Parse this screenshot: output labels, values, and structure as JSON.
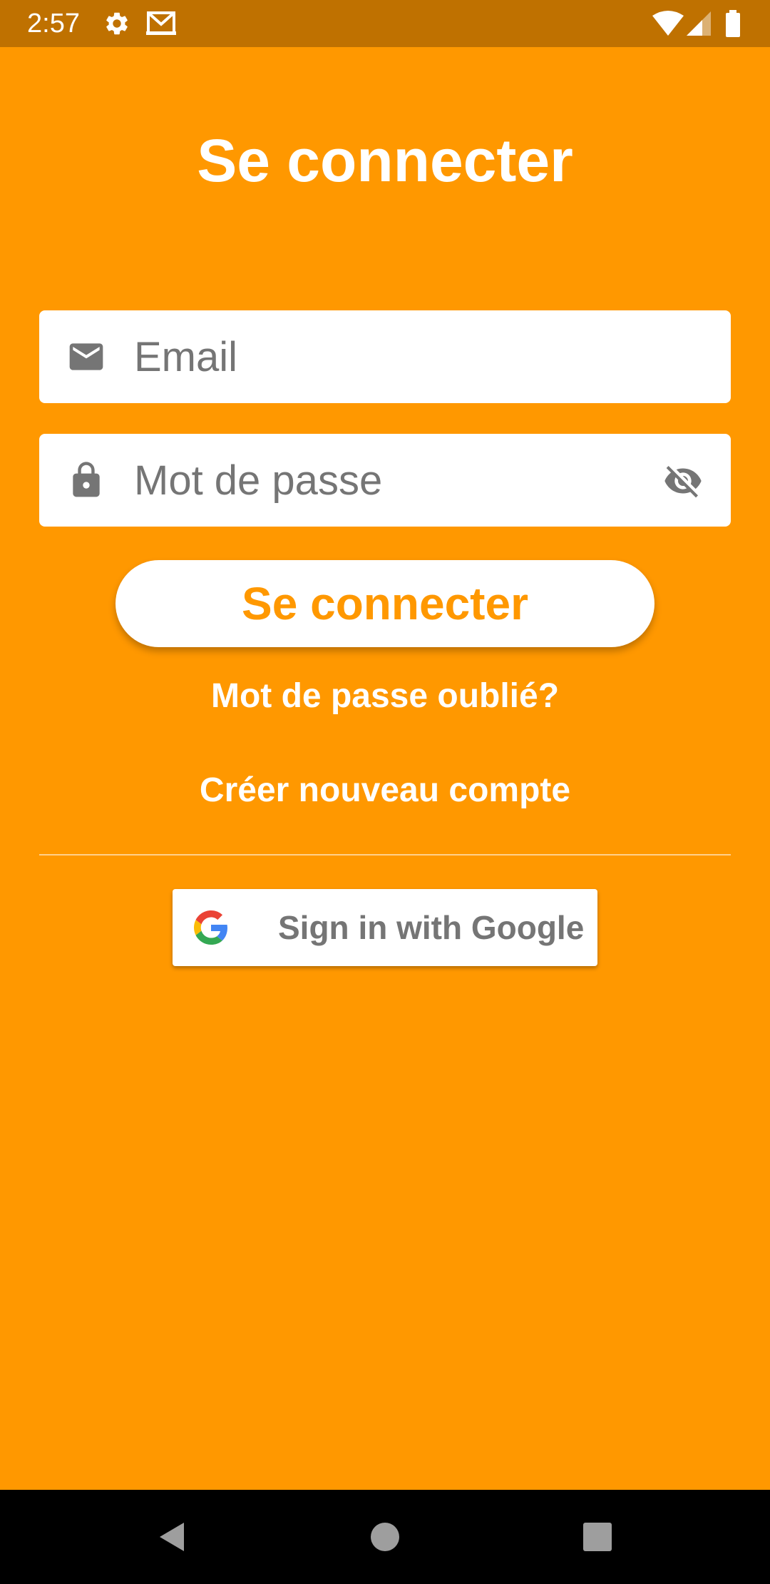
{
  "status_bar": {
    "time": "2:57",
    "icons": [
      "settings-icon",
      "gmail-icon",
      "wifi-icon",
      "signal-icon",
      "battery-icon"
    ]
  },
  "title": "Se connecter",
  "email": {
    "placeholder": "Email",
    "value": "",
    "icon": "mail-icon"
  },
  "password": {
    "placeholder": "Mot de passe",
    "value": "",
    "icon": "lock-icon",
    "toggle_icon": "visibility-off-icon"
  },
  "login_button": {
    "label": "Se connecter"
  },
  "forgot_password": {
    "label": "Mot de passe oublié?"
  },
  "create_account": {
    "label": "Créer nouveau compte"
  },
  "google_button": {
    "label": "Sign in with Google",
    "icon": "google-icon"
  },
  "nav_bar": {
    "buttons": [
      "back-icon",
      "home-icon",
      "recents-icon"
    ]
  },
  "colors": {
    "background": "#FF9800",
    "status_bar": "#BF7100",
    "accent_text": "#FF9800",
    "field_background": "#FFFFFF",
    "icon_gray": "#757575"
  }
}
